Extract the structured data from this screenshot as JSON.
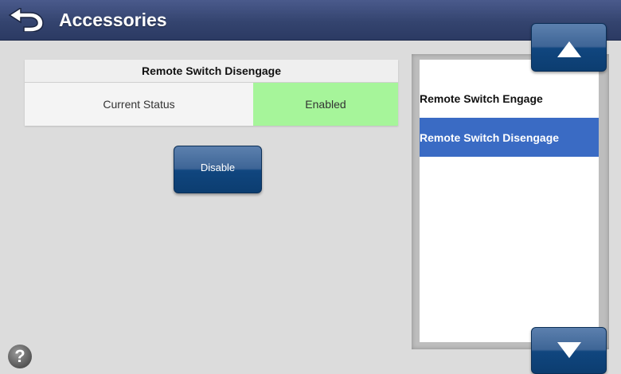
{
  "header": {
    "title": "Accessories",
    "back_icon": "back-arrow-icon"
  },
  "panel": {
    "title": "Remote Switch Disengage",
    "status_label": "Current Status",
    "status_value": "Enabled",
    "status_color": "#a6f59a"
  },
  "actions": {
    "disable_label": "Disable"
  },
  "list": {
    "items": [
      {
        "label": "Remote Switch Engage",
        "selected": false
      },
      {
        "label": "Remote Switch Disengage",
        "selected": true
      }
    ],
    "selected_color": "#3a6bc4"
  },
  "scroll": {
    "up_icon": "up-arrow-icon",
    "down_icon": "down-arrow-icon"
  },
  "help": {
    "symbol": "?",
    "icon": "help-icon"
  },
  "colors": {
    "header_bg": "#34446f",
    "button_bg": "#10467f",
    "page_bg": "#dcdcdc"
  }
}
